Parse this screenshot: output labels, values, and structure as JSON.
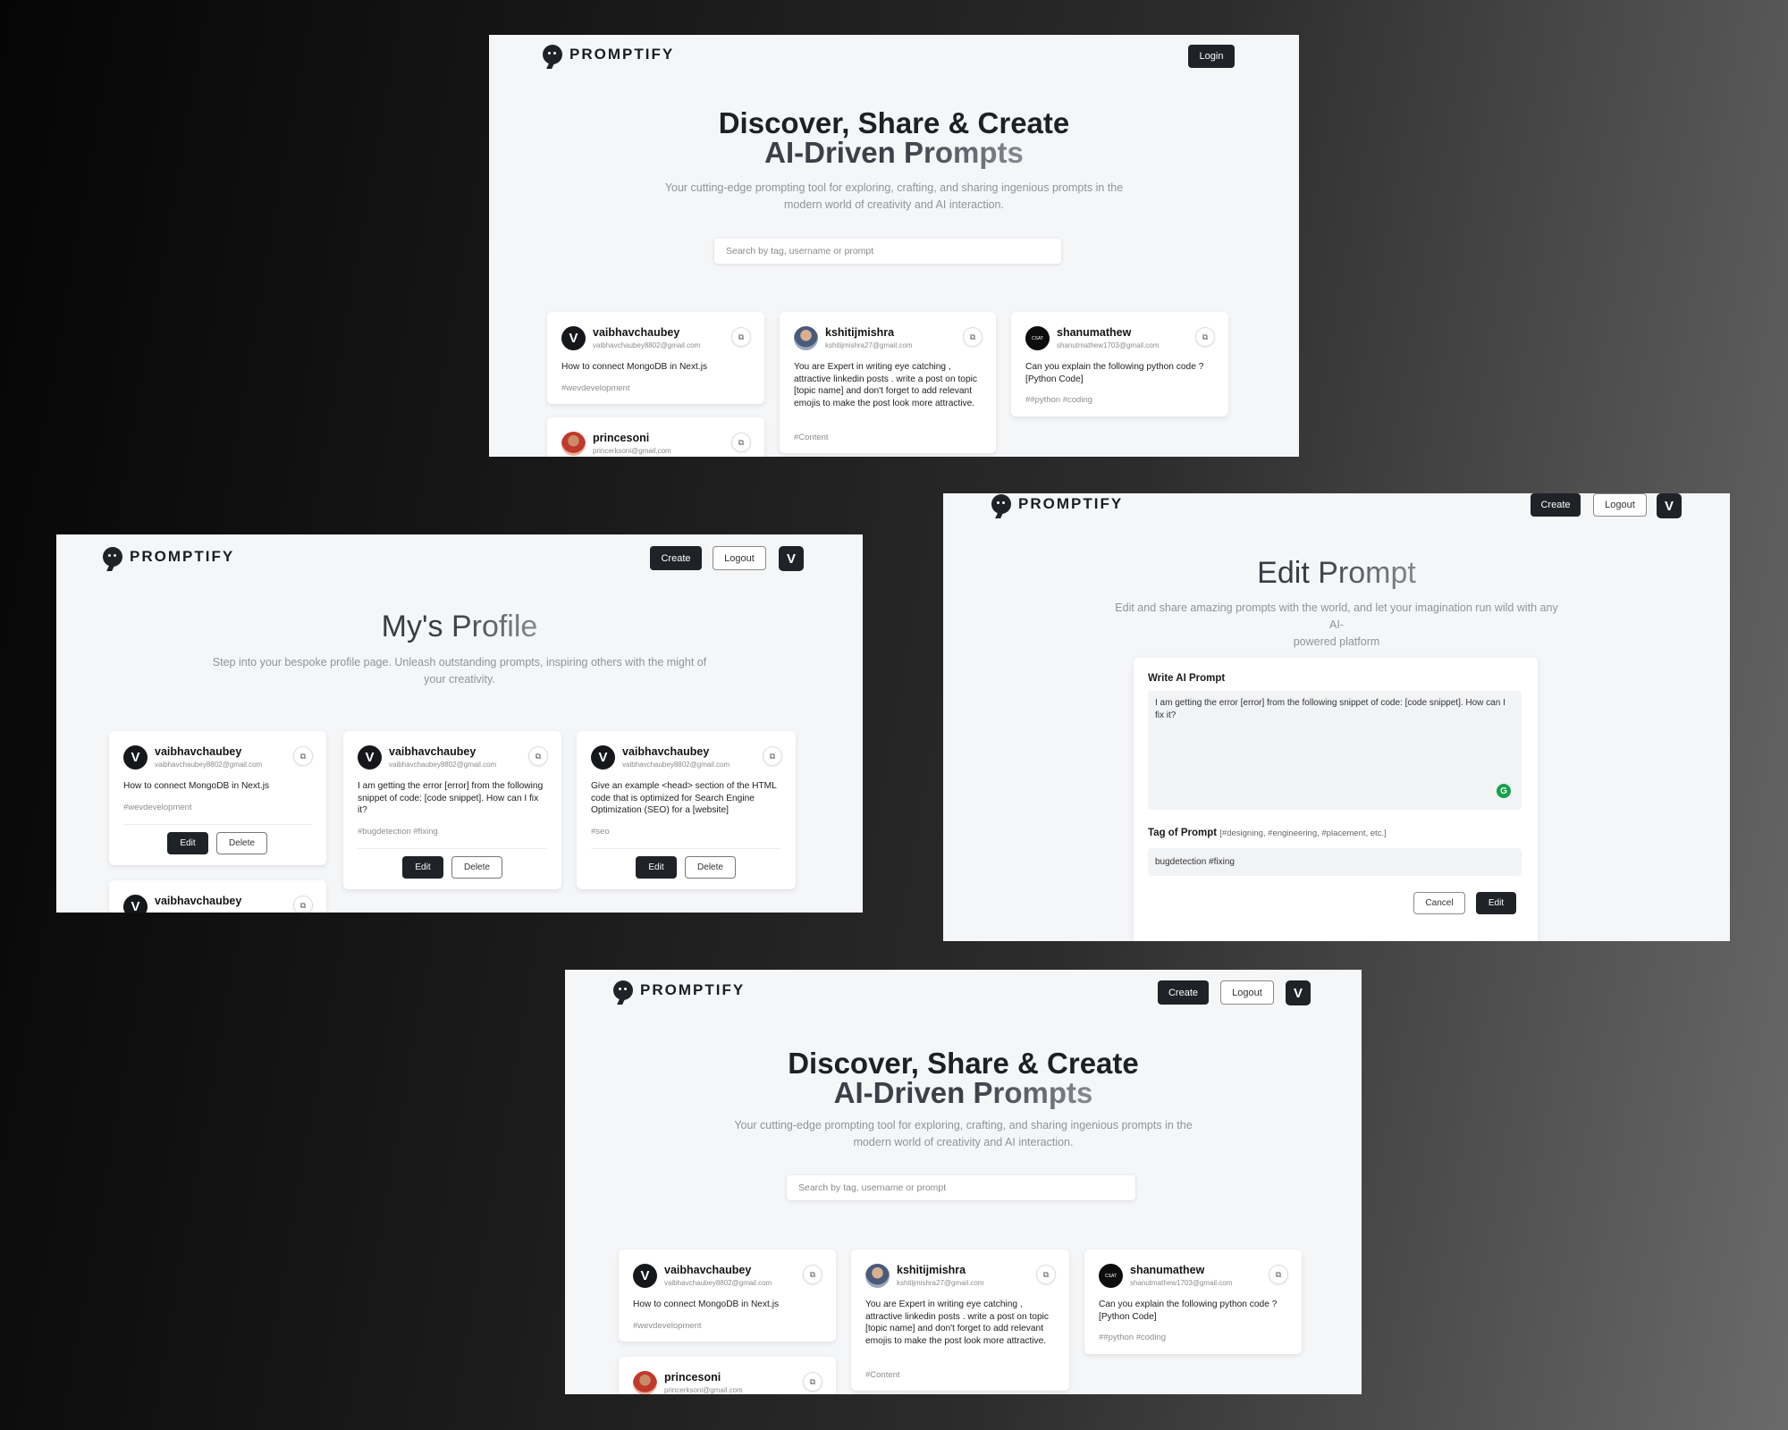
{
  "brand": {
    "name": "PROMPTIFY"
  },
  "nav": {
    "login": "Login",
    "create": "Create",
    "logout": "Logout"
  },
  "home": {
    "title_line1": "Discover, Share & Create",
    "title_line2_a": "AI-Driven ",
    "title_line2_b": "Prompts",
    "subtitle_line1": "Your cutting-edge prompting tool for exploring, crafting, and sharing ingenious prompts in the",
    "subtitle_line2": "modern world of creativity and AI interaction.",
    "search_placeholder": "Search by tag, username or prompt",
    "cards": [
      {
        "name": "vaibhavchaubey",
        "email": "vaibhavchaubey8802@gmail.com",
        "prompt": "How to connect MongoDB in Next.js",
        "tag": "#wevdevelopment"
      },
      {
        "name": "kshitijmishra",
        "email": "kshitijmishra27@gmail.com",
        "prompt": "You are Expert in writing eye catching , attractive linkedin posts . write a post on topic [topic name] and don't forget to add relevant emojis to make the post look more attractive.",
        "tag": "#Content"
      },
      {
        "name": "shanumathew",
        "email": "shanutmathew1703@gmail.com",
        "prompt": "Can you explain the following python code ? [Python Code]",
        "tag": "##python #coding"
      },
      {
        "name": "princesoni",
        "email": "princerksoni@gmail.com"
      }
    ]
  },
  "profile": {
    "title_a": "My's ",
    "title_b": "Profile",
    "subtitle_line1": "Step into your bespoke profile page. Unleash outstanding prompts, inspiring others with the might of",
    "subtitle_line2": "your creativity.",
    "edit_label": "Edit",
    "delete_label": "Delete",
    "cards": [
      {
        "name": "vaibhavchaubey",
        "email": "vaibhavchaubey8802@gmail.com",
        "prompt": "How to connect MongoDB in Next.js",
        "tag": "#wevdevelopment"
      },
      {
        "name": "vaibhavchaubey",
        "email": "vaibhavchaubey8802@gmail.com",
        "prompt": "I am getting the error [error] from the following snippet of code: [code snippet]. How can I fix it?",
        "tag": "#bugdetection #fixing"
      },
      {
        "name": "vaibhavchaubey",
        "email": "vaibhavchaubey8802@gmail.com",
        "prompt": "Give an example <head> section of the HTML code that is optimized for Search Engine Optimization (SEO) for a [website]",
        "tag": "#seo"
      },
      {
        "name": "vaibhavchaubey"
      }
    ]
  },
  "edit": {
    "title_a": "Edit ",
    "title_b": "Prompt",
    "subtitle_line1": "Edit and share amazing prompts with the world, and let your imagination run wild with any AI-",
    "subtitle_line2": "powered platform",
    "prompt_label": "Write AI Prompt",
    "prompt_value": "I am getting the error [error] from the following snippet of code: [code snippet]. How can I fix it?",
    "tag_label": "Tag of Prompt",
    "tag_hint": "[#designing, #engineering, #placement, etc.]",
    "tag_value": "bugdetection #fixing",
    "cancel": "Cancel",
    "submit": "Edit"
  },
  "colors": {
    "accent_dark": "#1f2227",
    "page_bg": "#f5f6f8"
  }
}
